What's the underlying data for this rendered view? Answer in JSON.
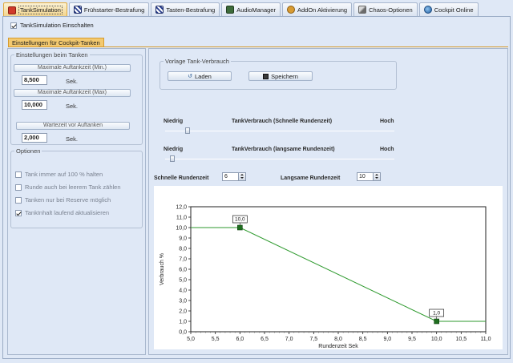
{
  "tabs": [
    {
      "label": "TankSimulation",
      "icon": "fuel-icon",
      "active": true
    },
    {
      "label": "Frühstarter-Bestrafung",
      "icon": "flag-icon",
      "active": false
    },
    {
      "label": "Tasten-Bestrafung",
      "icon": "flag-icon",
      "active": false
    },
    {
      "label": "AudioManager",
      "icon": "audio-icon",
      "active": false
    },
    {
      "label": "AddOn Aktivierung",
      "icon": "addon-icon",
      "active": false
    },
    {
      "label": "Chaos-Optionen",
      "icon": "chaos-icon",
      "active": false
    },
    {
      "label": "Cockpit Online",
      "icon": "globe-icon",
      "active": false
    }
  ],
  "enable_checkbox": {
    "label": "TankSimulation Einschalten",
    "checked": true
  },
  "section_title": "Einstellungen für Cockpit-Tanken",
  "refuel_group": {
    "legend": "Einstellungen beim Tanken",
    "max_refuel_min": {
      "label": "Maximale Auftankzeit (Min.)",
      "value": "8,500",
      "unit": "Sek."
    },
    "max_refuel_max": {
      "label": "Maximale Auftankzeit (Max)",
      "value": "10,000",
      "unit": "Sek."
    },
    "wait_before": {
      "label": "Wartezeit vor Auftanken",
      "value": "2,000",
      "unit": "Sek."
    }
  },
  "options_group": {
    "legend": "Optionen",
    "items": [
      {
        "label": "Tank immer auf 100 % halten",
        "checked": false
      },
      {
        "label": "Runde auch bei leerem Tank zählen",
        "checked": false
      },
      {
        "label": "Tanken nur bei Reserve möglich",
        "checked": false
      },
      {
        "label": "TankInhalt laufend aktualisieren",
        "checked": true
      }
    ]
  },
  "template_group": {
    "legend": "Vorlage Tank-Verbrauch",
    "load_label": "Laden",
    "save_label": "Speichern"
  },
  "slider_fast": {
    "low": "Niedrig",
    "title": "TankVerbrauch (Schnelle Rundenzeit)",
    "high": "Hoch",
    "level": 0.09
  },
  "slider_slow": {
    "low": "Niedrig",
    "title": "TankVerbrauch (langsame Rundenzeit)",
    "high": "Hoch",
    "level": 0.02
  },
  "laptimes": {
    "fast_label": "Schnelle Rundenzeit",
    "fast_value": "6",
    "slow_label": "Langsame Rundenzeit",
    "slow_value": "10"
  },
  "chart_data": {
    "type": "line",
    "xlabel": "Rundenzeit Sek",
    "ylabel": "Verbrauch %",
    "xlim": [
      5.0,
      11.0
    ],
    "ylim": [
      0.0,
      12.0
    ],
    "x_ticks": [
      "5,0",
      "5,5",
      "6,0",
      "6,5",
      "7,0",
      "7,5",
      "8,0",
      "8,5",
      "9,0",
      "9,5",
      "10,0",
      "10,5",
      "11,0"
    ],
    "y_ticks": [
      "0,0",
      "1,0",
      "2,0",
      "3,0",
      "4,0",
      "5,0",
      "6,0",
      "7,0",
      "8,0",
      "9,0",
      "10,0",
      "11,0",
      "12,0"
    ],
    "series": [
      {
        "x": [
          5.0,
          6.0,
          10.0,
          11.0
        ],
        "y": [
          10.0,
          10.0,
          1.0,
          1.0
        ],
        "color": "#2e9a2e"
      }
    ],
    "points": [
      {
        "x": 6.0,
        "y": 10.0,
        "label": "10,0"
      },
      {
        "x": 10.0,
        "y": 1.0,
        "label": "1,0"
      }
    ],
    "grid": false
  }
}
